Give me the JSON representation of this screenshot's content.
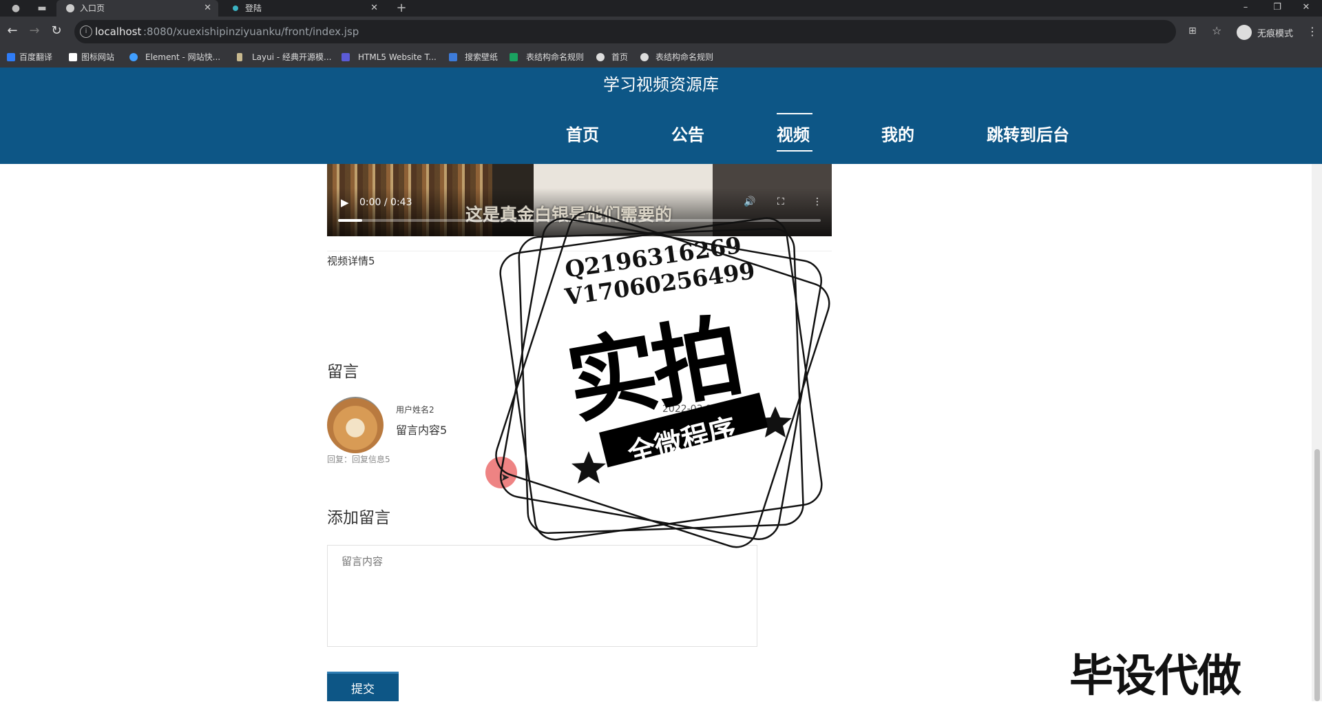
{
  "browser": {
    "tabs": [
      {
        "label": "入口页",
        "active": true
      },
      {
        "label": "登陆",
        "active": false
      }
    ],
    "url_host": "localhost",
    "url_path": ":8080/xuexishipinziyuanku/front/index.jsp",
    "profile_label": "无痕模式",
    "bookmarks": [
      {
        "label": "百度翻译",
        "color": "#2f7cf6"
      },
      {
        "label": "图标网站",
        "color": "#ffffff"
      },
      {
        "label": "Element - 网站快...",
        "color": "#409eff"
      },
      {
        "label": "Layui - 经典开源模...",
        "color": "#c8b98f"
      },
      {
        "label": "HTML5 Website T...",
        "color": "#5b5bd6"
      },
      {
        "label": "搜索壁纸",
        "color": "#3d7bd9"
      },
      {
        "label": "表结构命名规则",
        "color": "#1aa260"
      },
      {
        "label": "首页",
        "color": "#dddddd"
      },
      {
        "label": "表结构命名规则",
        "color": "#dddddd"
      }
    ]
  },
  "site": {
    "title": "学习视频资源库",
    "nav": [
      {
        "label": "首页",
        "active": false
      },
      {
        "label": "公告",
        "active": false
      },
      {
        "label": "视频",
        "active": true
      },
      {
        "label": "我的",
        "active": false
      },
      {
        "label": "跳转到后台",
        "active": false
      }
    ],
    "accent_color": "#0d5686"
  },
  "video": {
    "time": "0:00 / 0:43",
    "subtitle": "这是真金白银是他们需要的",
    "progress": 0.05
  },
  "detail": {
    "description": "视频详情5"
  },
  "comments": {
    "section_title": "留言",
    "items": [
      {
        "user": "用户姓名2",
        "content": "留言内容5",
        "time": "2022-03-29 20:00",
        "reply": "回复：回复信息5"
      }
    ]
  },
  "add_comment": {
    "section_title": "添加留言",
    "placeholder": "留言内容",
    "submit_label": "提交"
  },
  "watermark": {
    "qq": "Q2196316269",
    "wx": "V17060256499",
    "main": "实拍",
    "ribbon": "全微程序",
    "promo": "毕设代做"
  }
}
